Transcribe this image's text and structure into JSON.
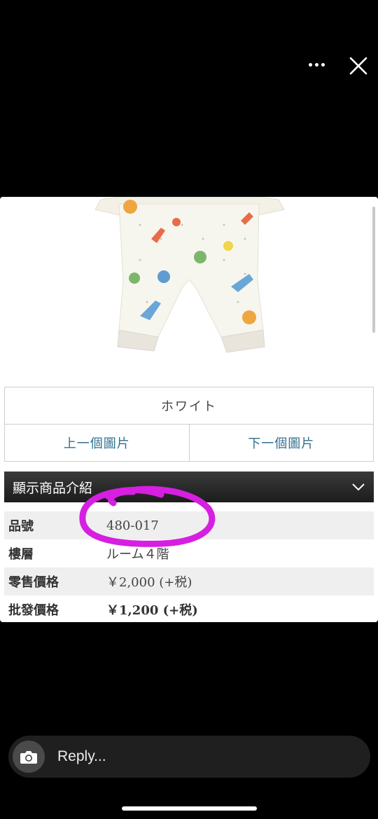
{
  "viewer": {
    "more_icon": "ellipsis-icon",
    "close_icon": "close-icon"
  },
  "product": {
    "color_label": "ホワイト",
    "prev_image_label": "上一個圖片",
    "next_image_label": "下一個圖片",
    "intro_label": "顯示商品介紹",
    "specs": [
      {
        "label": "品號",
        "value": "480-017"
      },
      {
        "label": "樓層",
        "value": "ルーム４階"
      },
      {
        "label": "零售價格",
        "value": "￥2,000 (+税)"
      },
      {
        "label": "批發價格",
        "value": "￥1,200 (+税)"
      }
    ]
  },
  "annotation": {
    "color": "#d61fe0"
  },
  "reply": {
    "placeholder": "Reply...",
    "camera_icon": "camera-icon"
  }
}
